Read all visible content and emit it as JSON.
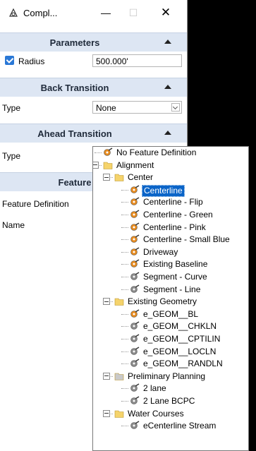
{
  "window": {
    "title": "Compl...",
    "min_glyph": "—",
    "max_glyph": "☐",
    "close_glyph": "✕"
  },
  "parameters": {
    "header": "Parameters",
    "radius_label": "Radius",
    "radius_checked": true,
    "radius_value": "500.000'"
  },
  "back_transition": {
    "header": "Back Transition",
    "type_label": "Type",
    "type_value": "None"
  },
  "ahead_transition": {
    "header": "Ahead Transition",
    "type_label": "Type"
  },
  "feature": {
    "header": "Feature",
    "definition_label": "Feature Definition",
    "name_label": "Name"
  },
  "tree": {
    "items": [
      {
        "label": "No Feature Definition",
        "kind": "feature",
        "level": 0
      },
      {
        "label": "Alignment",
        "kind": "folder",
        "level": 0
      },
      {
        "label": "Center",
        "kind": "folder",
        "level": 1
      },
      {
        "label": "Centerline",
        "kind": "feature",
        "level": 2,
        "selected": true
      },
      {
        "label": "Centerline - Flip",
        "kind": "feature",
        "level": 2
      },
      {
        "label": "Centerline - Green",
        "kind": "feature",
        "level": 2
      },
      {
        "label": "Centerline - Pink",
        "kind": "feature",
        "level": 2
      },
      {
        "label": "Centerline - Small Blue",
        "kind": "feature",
        "level": 2
      },
      {
        "label": "Driveway",
        "kind": "feature",
        "level": 2
      },
      {
        "label": "Existing Baseline",
        "kind": "feature",
        "level": 2
      },
      {
        "label": "Segment - Curve",
        "kind": "feature-gray",
        "level": 2
      },
      {
        "label": "Segment - Line",
        "kind": "feature-gray",
        "level": 2
      },
      {
        "label": "Existing Geometry",
        "kind": "folder",
        "level": 1
      },
      {
        "label": "e_GEOM__BL",
        "kind": "feature",
        "level": 2
      },
      {
        "label": "e_GEOM__CHKLN",
        "kind": "feature-gray",
        "level": 2
      },
      {
        "label": "e_GEOM__CPTILIN",
        "kind": "feature-gray",
        "level": 2
      },
      {
        "label": "e_GEOM__LOCLN",
        "kind": "feature-gray",
        "level": 2
      },
      {
        "label": "e_GEOM__RANDLN",
        "kind": "feature-gray",
        "level": 2
      },
      {
        "label": "Preliminary Planning",
        "kind": "folder-gray",
        "level": 1
      },
      {
        "label": "2 lane",
        "kind": "feature-gray",
        "level": 2
      },
      {
        "label": "2 Lane BCPC",
        "kind": "feature-gray",
        "level": 2
      },
      {
        "label": "Water Courses",
        "kind": "folder",
        "level": 1
      },
      {
        "label": "eCenterline Stream",
        "kind": "feature-gray",
        "level": 2
      }
    ]
  },
  "colors": {
    "section_header_bg": "#dde6f3",
    "selection_bg": "#0a64c8",
    "checkbox": "#2a78d6",
    "folder": "#f5d36b",
    "feature_orange": "#e58a1f"
  }
}
